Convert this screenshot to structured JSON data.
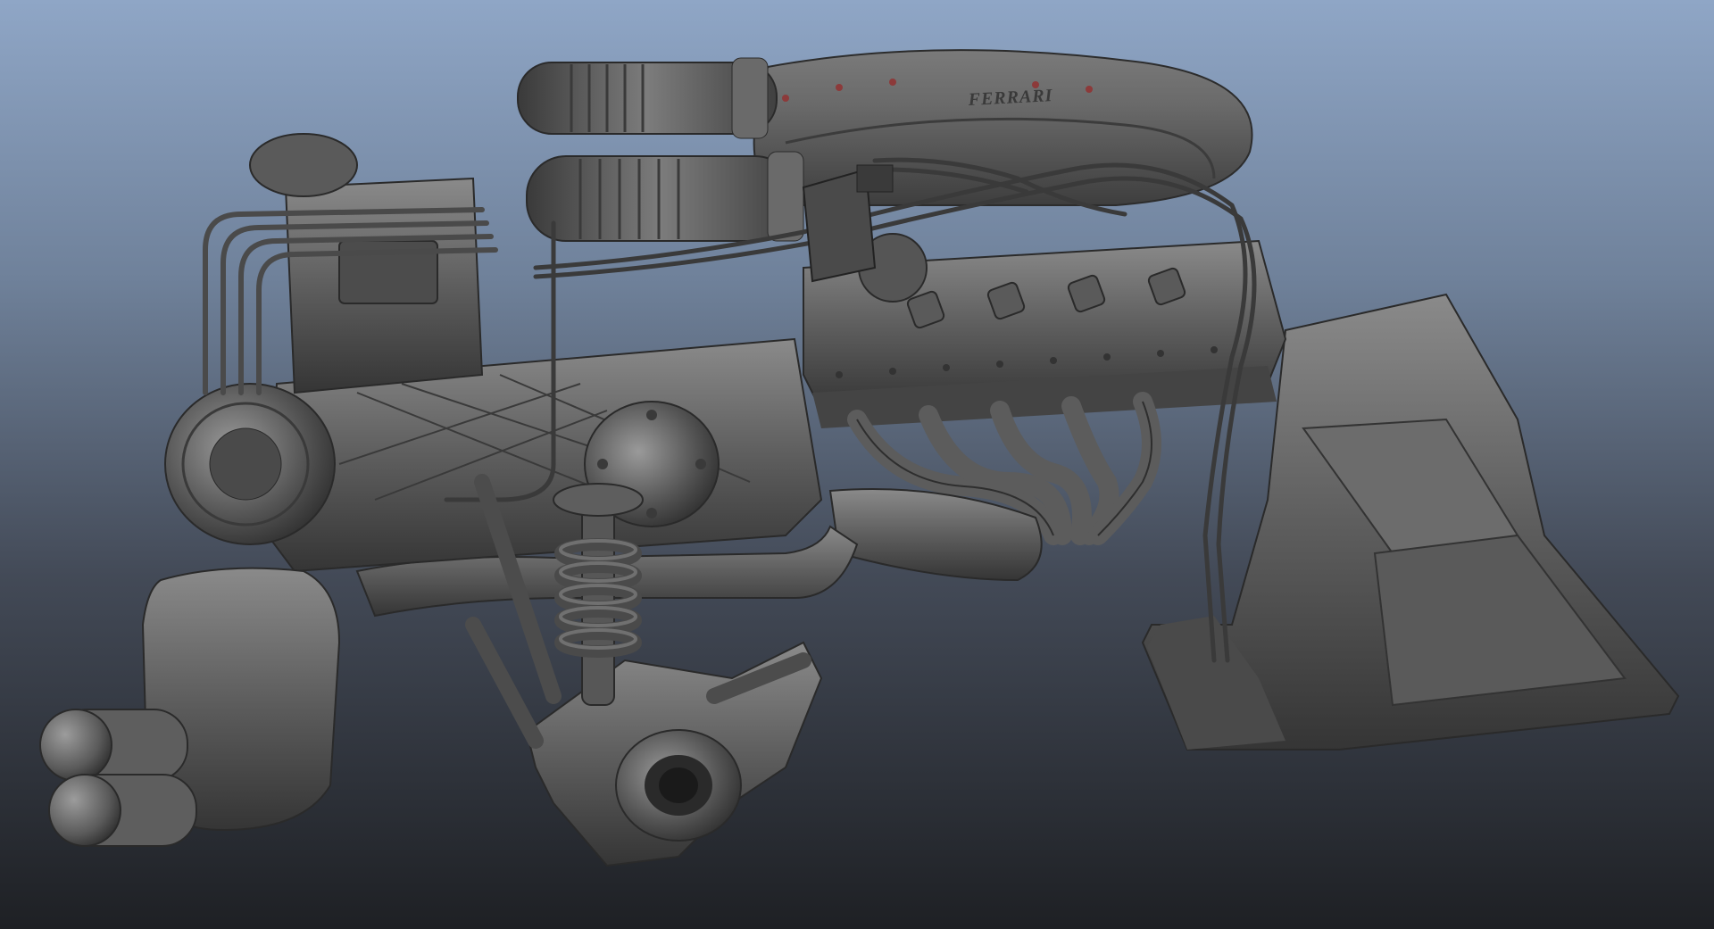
{
  "viewport": {
    "background_top": "#8fa6c6",
    "background_bottom": "#1e2024"
  },
  "model": {
    "logo_text": "FERRARI",
    "base_color": "#5e5e5e",
    "shadow_color": "#2c2c2c",
    "highlight_color": "#9a9a9a"
  }
}
